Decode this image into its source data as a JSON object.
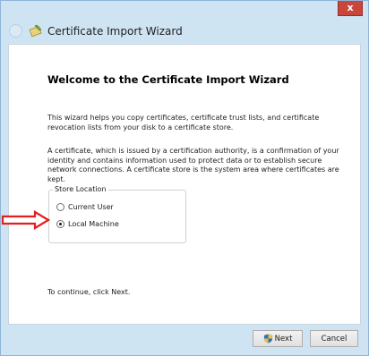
{
  "window": {
    "title": "Certificate Import Wizard",
    "close_glyph": "x"
  },
  "page": {
    "heading": "Welcome to the Certificate Import Wizard",
    "paragraph1": "This wizard helps you copy certificates, certificate trust lists, and certificate revocation lists from your disk to a certificate store.",
    "paragraph2": "A certificate, which is issued by a certification authority, is a confirmation of your identity and contains information used to protect data or to establish secure network connections. A certificate store is the system area where certificates are kept.",
    "store_location": {
      "label": "Store Location",
      "options": [
        {
          "label": "Current User",
          "selected": false
        },
        {
          "label": "Local Machine",
          "selected": true
        }
      ]
    },
    "continue_text": "To continue, click Next."
  },
  "footer": {
    "next_label": "Next",
    "cancel_label": "Cancel"
  },
  "icons": {
    "back": "back-arrow-icon",
    "wizard": "certificate-wizard-icon",
    "shield": "uac-shield-icon",
    "annotation": "red-arrow-icon"
  },
  "colors": {
    "annotation_arrow": "#e02020",
    "close_button": "#c9463d",
    "frame": "#cfe4f3"
  }
}
